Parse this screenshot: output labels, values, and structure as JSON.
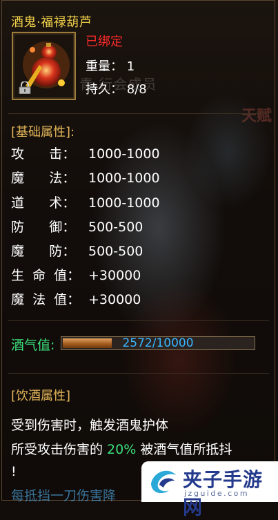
{
  "item": {
    "title": "酒鬼·福禄葫芦",
    "bound": "已绑定",
    "weight": "重量：  1",
    "durability": "持久：  8/8",
    "watermark_guild": "青      行会成员",
    "watermark_side": "天赋"
  },
  "base_section": "[基础属性]:",
  "attributes": [
    {
      "label": "攻      击：",
      "value": "1000-1000"
    },
    {
      "label": "魔      法：",
      "value": "1000-1000"
    },
    {
      "label": "道      术：",
      "value": "1000-1000"
    },
    {
      "label": "防      御：",
      "value": "500-500"
    },
    {
      "label": "魔      防：",
      "value": "500-500"
    },
    {
      "label": "生  命  值：",
      "value": "+30000"
    },
    {
      "label": "魔  法  值：",
      "value": "+30000"
    }
  ],
  "wine": {
    "label": "酒气值:",
    "text": "2572/10000",
    "fraction": 0.2572
  },
  "drink_section": "[饮酒属性]",
  "description": {
    "line1": "受到伤害时，触发酒鬼护体",
    "line2_pre": "所受攻击伤害的 ",
    "line2_pct": "20%",
    "line2_post": " 被酒气值所抵抖",
    "line3": "!",
    "line4": "每抵挡一刀伤害降"
  },
  "brand": {
    "name": "夹子手游网",
    "url": "jzguide.com"
  },
  "colors": {
    "title": "#f2d24b",
    "bound": "#ff2a2a",
    "section": "#e6b85a",
    "wine_label": "#3be07c",
    "bar_text": "#3bb6ff",
    "brand": "#243a8c"
  }
}
